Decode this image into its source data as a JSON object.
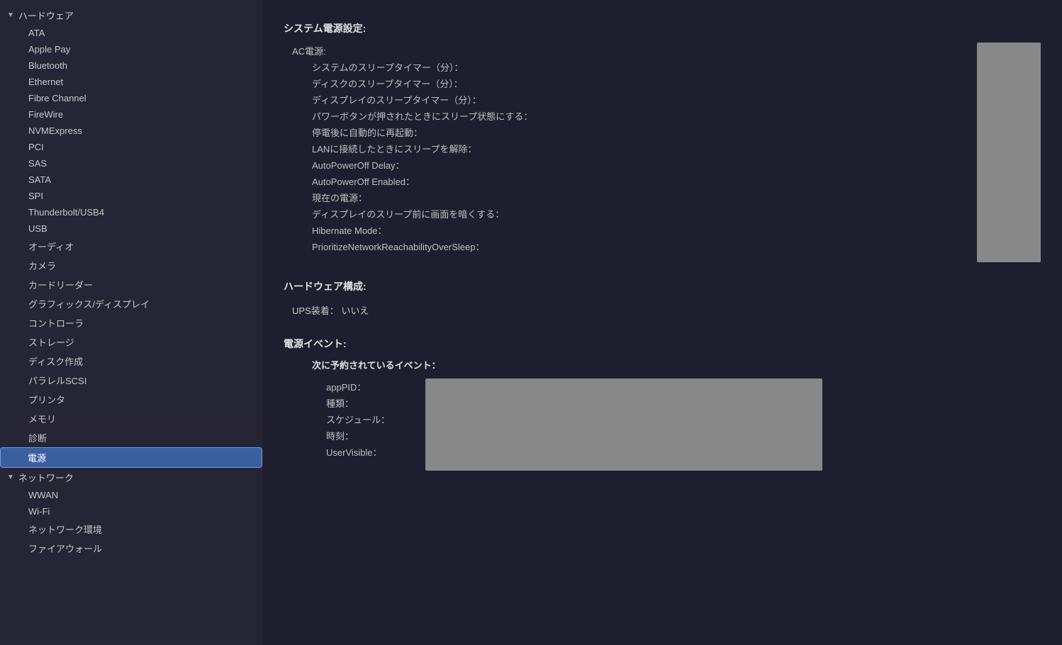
{
  "sidebar": {
    "groups": [
      {
        "id": "hardware",
        "label": "ハードウェア",
        "expanded": true,
        "items": [
          {
            "id": "ata",
            "label": "ATA"
          },
          {
            "id": "apple-pay",
            "label": "Apple Pay"
          },
          {
            "id": "bluetooth",
            "label": "Bluetooth"
          },
          {
            "id": "ethernet",
            "label": "Ethernet"
          },
          {
            "id": "fibre-channel",
            "label": "Fibre Channel"
          },
          {
            "id": "firewire",
            "label": "FireWire"
          },
          {
            "id": "nvmexpress",
            "label": "NVMExpress"
          },
          {
            "id": "pci",
            "label": "PCI"
          },
          {
            "id": "sas",
            "label": "SAS"
          },
          {
            "id": "sata",
            "label": "SATA"
          },
          {
            "id": "spi",
            "label": "SPI"
          },
          {
            "id": "thunderbolt",
            "label": "Thunderbolt/USB4"
          },
          {
            "id": "usb",
            "label": "USB"
          },
          {
            "id": "audio",
            "label": "オーディオ"
          },
          {
            "id": "camera",
            "label": "カメラ"
          },
          {
            "id": "card-reader",
            "label": "カードリーダー"
          },
          {
            "id": "graphics",
            "label": "グラフィックス/ディスプレイ"
          },
          {
            "id": "controller",
            "label": "コントローラ"
          },
          {
            "id": "storage",
            "label": "ストレージ"
          },
          {
            "id": "disk-creation",
            "label": "ディスク作成"
          },
          {
            "id": "parallel-scsi",
            "label": "パラレルSCSI"
          },
          {
            "id": "printer",
            "label": "プリンタ"
          },
          {
            "id": "memory",
            "label": "メモリ"
          },
          {
            "id": "diagnostics",
            "label": "診断"
          },
          {
            "id": "power",
            "label": "電源",
            "active": true
          }
        ]
      },
      {
        "id": "network",
        "label": "ネットワーク",
        "expanded": true,
        "items": [
          {
            "id": "wwan",
            "label": "WWAN"
          },
          {
            "id": "wifi",
            "label": "Wi-Fi"
          },
          {
            "id": "network-env",
            "label": "ネットワーク環境"
          },
          {
            "id": "firewall",
            "label": "ファイアウォール"
          }
        ]
      }
    ]
  },
  "main": {
    "system_power_title": "システム電源設定:",
    "ac_power_label": "AC電源:",
    "ac_rows": [
      {
        "label": "システムのスリープタイマー（分）：",
        "value": ""
      },
      {
        "label": "ディスクのスリープタイマー（分）：",
        "value": ""
      },
      {
        "label": "ディスプレイのスリープタイマー（分）：",
        "value": ""
      },
      {
        "label": "パワーボタンが押されたときにスリープ状態にする：",
        "value": ""
      },
      {
        "label": "停電後に自動的に再起動：",
        "value": ""
      },
      {
        "label": "LANに接続したときにスリープを解除：",
        "value": ""
      },
      {
        "label": "AutoPowerOff Delay：",
        "value": ""
      },
      {
        "label": "AutoPowerOff Enabled：",
        "value": ""
      },
      {
        "label": "現在の電源：",
        "value": ""
      },
      {
        "label": "ディスプレイのスリープ前に画面を暗くする：",
        "value": ""
      },
      {
        "label": "Hibernate Mode：",
        "value": ""
      },
      {
        "label": "PrioritizeNetworkReachabilityOverSleep：",
        "value": ""
      }
    ],
    "hardware_config_title": "ハードウェア構成:",
    "ups_label": "UPS装着：",
    "ups_value": "いいえ",
    "power_events_title": "電源イベント:",
    "scheduled_events_title": "次に予約されているイベント：",
    "scheduled_rows": [
      {
        "label": "appPID：",
        "value": ""
      },
      {
        "label": "種類：",
        "value": ""
      },
      {
        "label": "スケジュール：",
        "value": ""
      },
      {
        "label": "時刻：",
        "value": ""
      },
      {
        "label": "UserVisible：",
        "value": ""
      }
    ]
  }
}
